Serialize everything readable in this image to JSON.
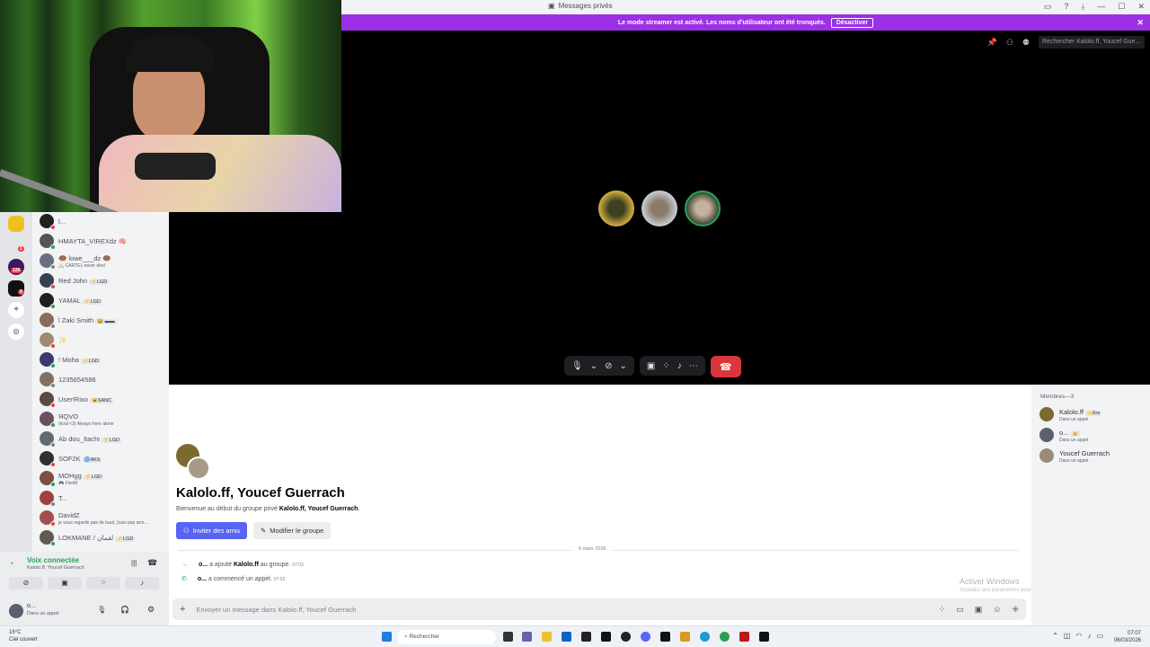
{
  "titlebar": {
    "title": "Messages privés"
  },
  "banner": {
    "text": "Le mode streamer est activé. Les noms d'utilisateur ont été tronqués.",
    "button": "Désactiver"
  },
  "call": {
    "search_placeholder": "Rechercher Kalolo.ff, Youcef Gue..."
  },
  "dms": [
    {
      "name": "l...",
      "color": "#222"
    },
    {
      "name": "HMAYTA_VIREXdz 🧠",
      "color": "#555"
    },
    {
      "name": "🍩 lowe___dz 🍩",
      "sub": "⚔️ CARTEL never died",
      "color": "#6a7080"
    },
    {
      "name": "Red John",
      "tag": "⚡LGD",
      "color": "#354050"
    },
    {
      "name": "YAMAL",
      "tag": "⚡LGD",
      "color": "#202020"
    },
    {
      "name": "l Zaki Smith",
      "tag": "😂 ▬▬",
      "color": "#8a6a5a"
    },
    {
      "name": "✨",
      "color": "#a08a70"
    },
    {
      "name": "! Moha",
      "tag": "⚡LGD",
      "color": "#3a3a70"
    },
    {
      "name": "1235654586",
      "color": "#807060"
    },
    {
      "name": "User!Rixo",
      "tag": "😺SANC",
      "color": "#5a4a40"
    },
    {
      "name": "ЯQVO",
      "sub": "(koal <3) Always here alone",
      "color": "#6a5060"
    },
    {
      "name": "Ab dou_Itachi",
      "tag": "⚡LGD",
      "color": "#606a70"
    },
    {
      "name": "SOF2K",
      "tag": "🌀AKS",
      "color": "#303030"
    },
    {
      "name": "MOHgg",
      "tag": "⚡LGD",
      "sub": "🎮 FiveM",
      "color": "#7a5040"
    },
    {
      "name": "T...",
      "color": "#a04040"
    },
    {
      "name": "DavidZ",
      "sub": "je vous regarde pas de haut, j'suis pas arro...",
      "color": "#a05050"
    },
    {
      "name": "LOKMANE / لقمان",
      "tag": "⚡LGD",
      "color": "#605a50"
    }
  ],
  "voice": {
    "title": "Voix connectée",
    "sub": "Kalolo.ff, Youcef Guerrach"
  },
  "user": {
    "name": "o...",
    "status": "Dans un appel"
  },
  "chat": {
    "title": "Kalolo.ff, Youcef Guerrach",
    "desc_prefix": "Bienvenue au début du groupe privé ",
    "desc_names": "Kalolo.ff, Youcef Guerrach",
    "desc_suffix": ".",
    "invite": "Inviter des amis",
    "edit": "Modifier le groupe",
    "date": "6 mars 2026",
    "sys1_user": "o...",
    "sys1_mid": " a ajouté ",
    "sys1_target": "Kalolo.ff",
    "sys1_end": " au groupe.",
    "sys1_time": "07:03",
    "sys2_user": "o...",
    "sys2_text": " a commencé un appel.",
    "sys2_time": "07:03",
    "composer_placeholder": "Envoyer un message dans Kalolo.ff, Youcef Guerrach",
    "activate_title": "Activer Windows",
    "activate_sub": "Accédez aux paramètres pour activer Windows."
  },
  "members": {
    "header": "Membres—3",
    "list": [
      {
        "name": "Kalolo.ff",
        "tag": "🌟Era",
        "status": "Dans un appel",
        "color": "#7a6a30"
      },
      {
        "name": "o...",
        "tag": "👑",
        "status": "Dans un appel",
        "color": "#5a6070"
      },
      {
        "name": "Youcef Guerrach",
        "status": "Dans un appel",
        "color": "#9a8a7a"
      }
    ]
  },
  "taskbar": {
    "temp": "16°C",
    "weather": "Ciel couvert",
    "search": "Rechercher",
    "time": "07:07",
    "date": "06/03/2026"
  }
}
